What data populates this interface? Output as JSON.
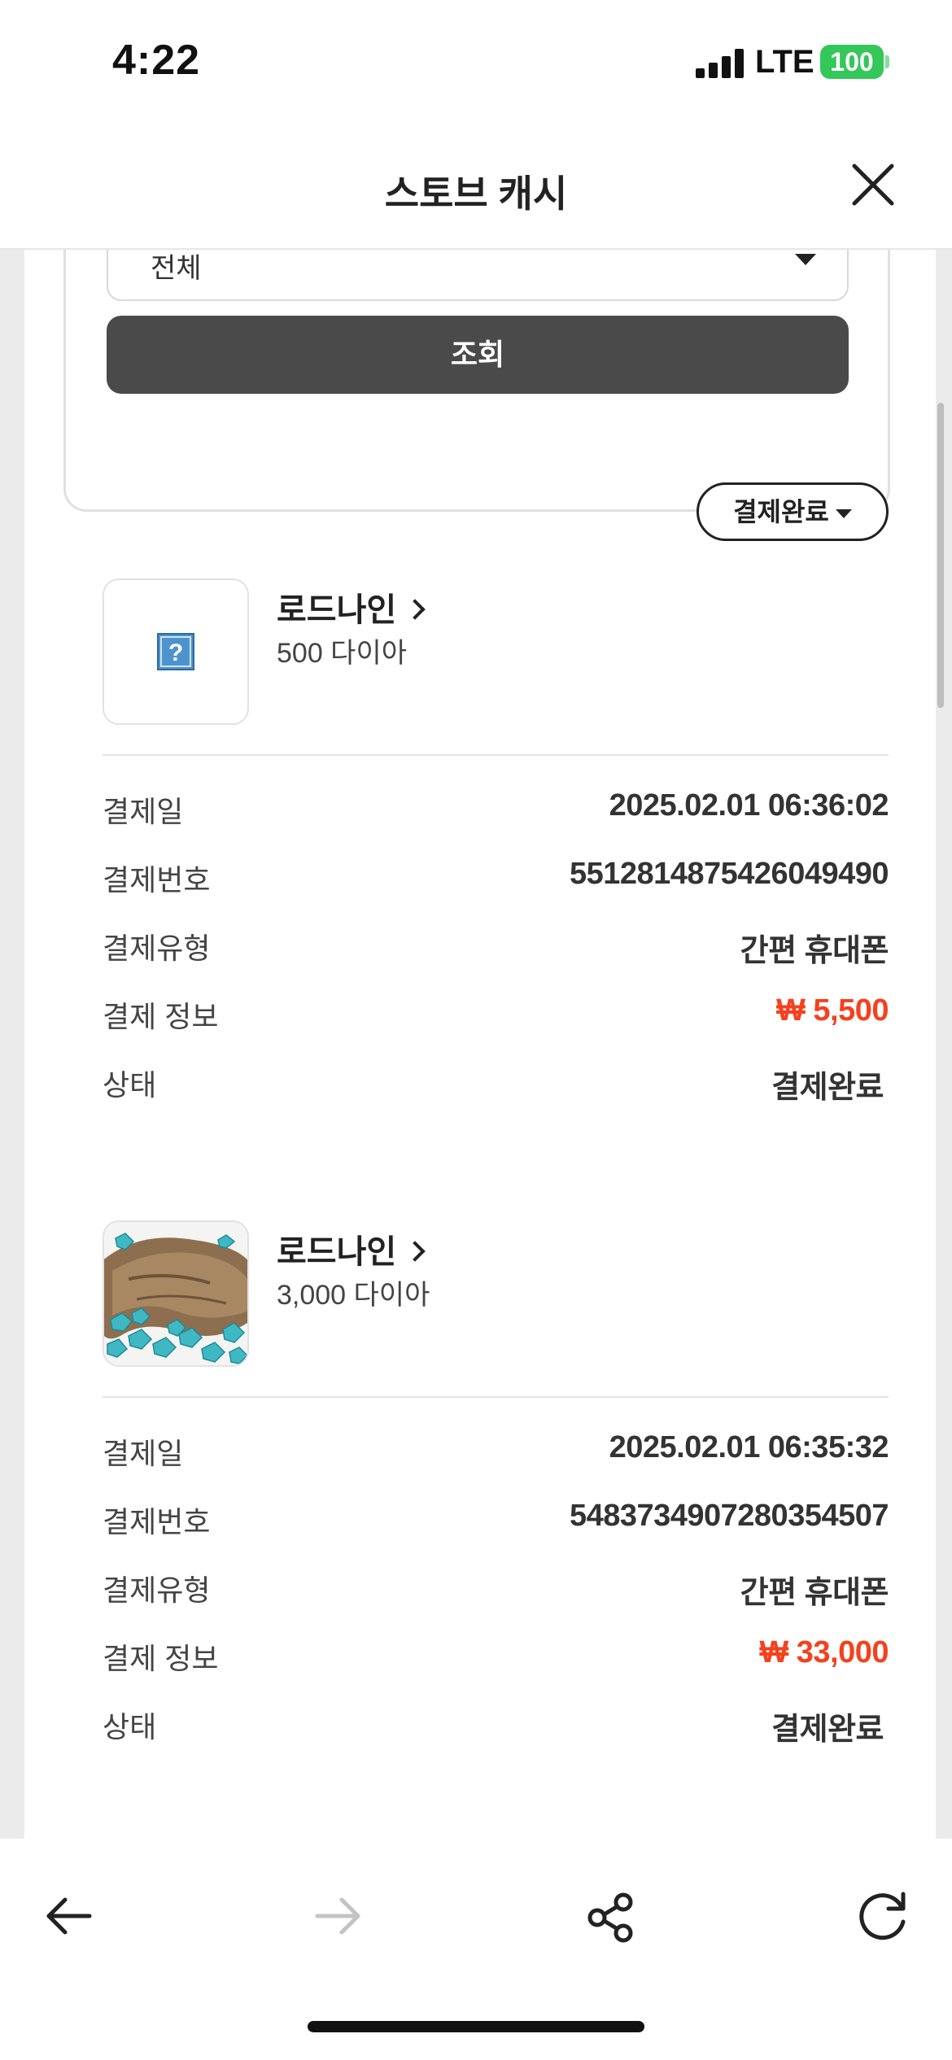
{
  "status_bar": {
    "time": "4:22",
    "network": "LTE",
    "battery": "100"
  },
  "header": {
    "title": "스토브 캐시"
  },
  "filter": {
    "select_value": "전체",
    "search_label": "조회"
  },
  "status_filter": {
    "label": "결제완료"
  },
  "orders": [
    {
      "product_name": "로드나인",
      "quantity": "500 다이아",
      "thumbnail": "missing-image-icon",
      "rows": [
        {
          "label": "결제일",
          "value": "2025.02.01 06:36:02"
        },
        {
          "label": "결제번호",
          "value": "5512814875426049490"
        },
        {
          "label": "결제유형",
          "value": "간편 휴대폰"
        },
        {
          "label": "결제 정보",
          "value": "₩ 5,500"
        },
        {
          "label": "상태",
          "value": "결제완료"
        }
      ]
    },
    {
      "product_name": "로드나인",
      "quantity": "3,000 다이아",
      "thumbnail": "diamond-bag-image",
      "rows": [
        {
          "label": "결제일",
          "value": "2025.02.01 06:35:32"
        },
        {
          "label": "결제번호",
          "value": "5483734907280354507"
        },
        {
          "label": "결제유형",
          "value": "간편 휴대폰"
        },
        {
          "label": "결제 정보",
          "value": "₩ 33,000"
        },
        {
          "label": "상태",
          "value": "결제완료"
        }
      ]
    }
  ],
  "colors": {
    "price": "#f4411e",
    "battery": "#34c759",
    "search_button": "#4a4a4a"
  },
  "toolbar": {
    "icons": [
      "back-arrow-icon",
      "forward-arrow-icon",
      "share-icon",
      "reload-icon"
    ]
  }
}
